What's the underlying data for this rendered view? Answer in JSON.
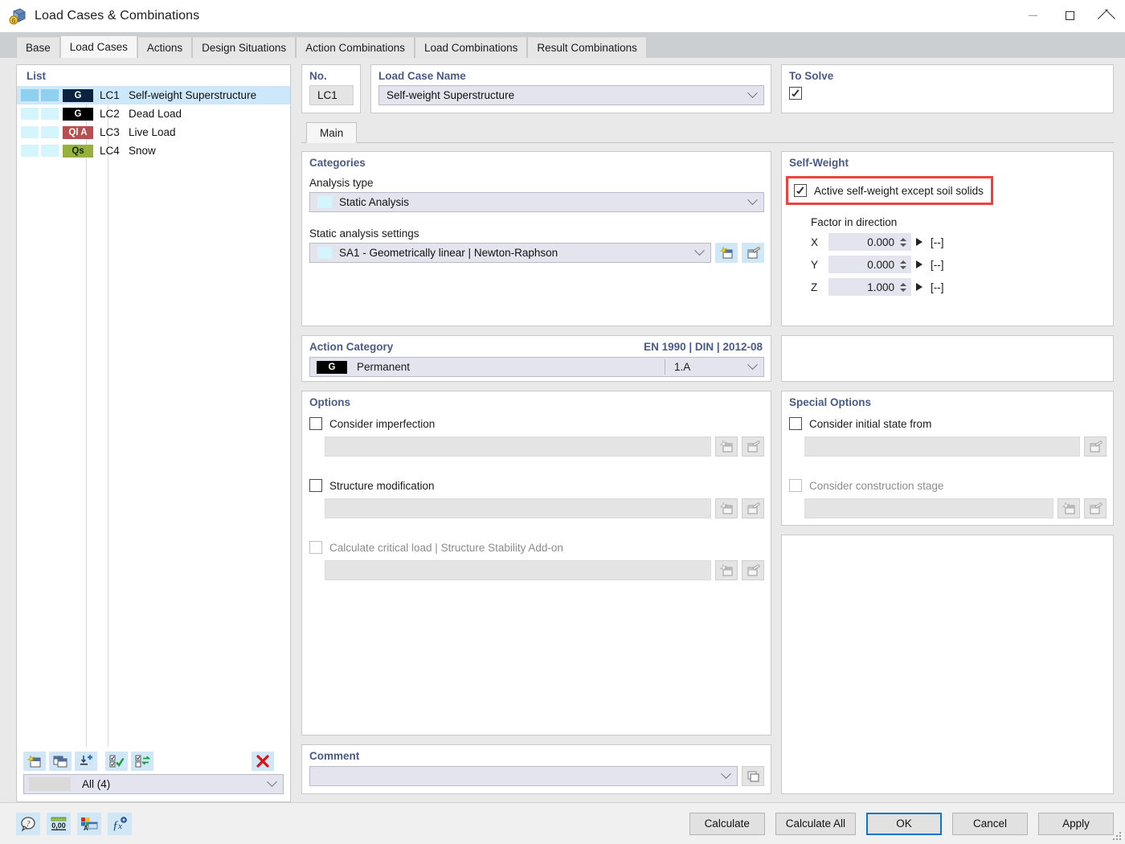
{
  "window": {
    "title": "Load Cases & Combinations",
    "icon": "app-cube-icon",
    "minimize": "minimize-icon",
    "maximize": "maximize-icon",
    "close": "close-icon"
  },
  "tabs": [
    {
      "label": "Base",
      "active": false
    },
    {
      "label": "Load Cases",
      "active": true
    },
    {
      "label": "Actions",
      "active": false
    },
    {
      "label": "Design Situations",
      "active": false
    },
    {
      "label": "Action Combinations",
      "active": false
    },
    {
      "label": "Load Combinations",
      "active": false
    },
    {
      "label": "Result Combinations",
      "active": false
    }
  ],
  "list": {
    "title": "List",
    "rows": [
      {
        "badge": "G",
        "badge_color": "#0c2340",
        "no": "LC1",
        "name": "Self-weight Superstructure",
        "selected": true
      },
      {
        "badge": "G",
        "badge_color": "#000000",
        "no": "LC2",
        "name": "Dead Load",
        "selected": false
      },
      {
        "badge": "Ql A",
        "badge_color": "#b74f4f",
        "no": "LC3",
        "name": "Live Load",
        "selected": false
      },
      {
        "badge": "Qs",
        "badge_color": "#97b13d",
        "no": "LC4",
        "name": "Snow",
        "selected": false
      }
    ],
    "toolbar": [
      {
        "name": "new-load-case-button",
        "icon": "new-window-icon"
      },
      {
        "name": "copy-load-case-button",
        "icon": "copy-window-icon"
      },
      {
        "name": "insert-load-case-button",
        "icon": "insert-down-icon"
      },
      {
        "name": "select-all-button",
        "icon": "check-all-icon"
      },
      {
        "name": "invert-selection-button",
        "icon": "invert-check-icon"
      },
      {
        "name": "delete-load-case-button",
        "icon": "delete-x-icon"
      }
    ],
    "filter": {
      "label": "All (4)",
      "chevron": "chevron-down-icon"
    }
  },
  "header": {
    "no_label": "No.",
    "no_value": "LC1",
    "name_label": "Load Case Name",
    "name_value": "Self-weight Superstructure",
    "solve_label": "To Solve",
    "solve_checked": true
  },
  "inner_tabs": [
    {
      "label": "Main",
      "active": true
    }
  ],
  "categories": {
    "title": "Categories",
    "analysis_type_label": "Analysis type",
    "analysis_type_value": "Static Analysis",
    "settings_label": "Static analysis settings",
    "settings_value": "SA1 - Geometrically linear | Newton-Raphson",
    "new_button": "new-settings-icon",
    "edit_button": "edit-settings-icon"
  },
  "action_category": {
    "title": "Action Category",
    "standard": "EN 1990 | DIN | 2012-08",
    "badge": "G",
    "badge_color": "#000000",
    "name": "Permanent",
    "code": "1.A"
  },
  "options": {
    "title": "Options",
    "items": [
      {
        "label": "Consider imperfection",
        "checked": false,
        "disabled": false,
        "field": "",
        "buttons": [
          "new-icon",
          "edit-icon"
        ]
      },
      {
        "label": "Structure modification",
        "checked": false,
        "disabled": false,
        "field": "",
        "buttons": [
          "new-icon",
          "edit-icon"
        ]
      },
      {
        "label": "Calculate critical load | Structure Stability Add-on",
        "checked": false,
        "disabled": true,
        "field": "",
        "buttons": [
          "new-icon",
          "edit-icon"
        ]
      }
    ]
  },
  "self_weight": {
    "title": "Self-Weight",
    "active_label": "Active self-weight except soil solids",
    "active_checked": true,
    "highlight_color": "#f0423c",
    "factor_label": "Factor in direction",
    "factors": [
      {
        "axis": "X",
        "value": "0.000",
        "unit": "[--]"
      },
      {
        "axis": "Y",
        "value": "0.000",
        "unit": "[--]"
      },
      {
        "axis": "Z",
        "value": "1.000",
        "unit": "[--]"
      }
    ]
  },
  "special_options": {
    "title": "Special Options",
    "items": [
      {
        "label": "Consider initial state from",
        "checked": false,
        "disabled": false,
        "buttons": [
          "edit-icon"
        ]
      },
      {
        "label": "Consider construction stage",
        "checked": false,
        "disabled": true,
        "buttons": [
          "new-icon",
          "edit-icon"
        ]
      }
    ]
  },
  "comment": {
    "title": "Comment",
    "value": "",
    "chevron": "chevron-down-icon",
    "button": "comment-copy-icon"
  },
  "footer": {
    "icons": [
      {
        "name": "help-button",
        "icon": "help-balloon-icon"
      },
      {
        "name": "units-button",
        "icon": "decimal-ruler-icon"
      },
      {
        "name": "display-properties-button",
        "icon": "color-palette-icon"
      },
      {
        "name": "formula-button",
        "icon": "function-icon"
      }
    ],
    "buttons": [
      {
        "label": "Calculate",
        "primary": false
      },
      {
        "label": "Calculate All",
        "primary": false
      },
      {
        "label": "OK",
        "primary": true
      },
      {
        "label": "Cancel",
        "primary": false
      },
      {
        "label": "Apply",
        "primary": false
      }
    ]
  }
}
